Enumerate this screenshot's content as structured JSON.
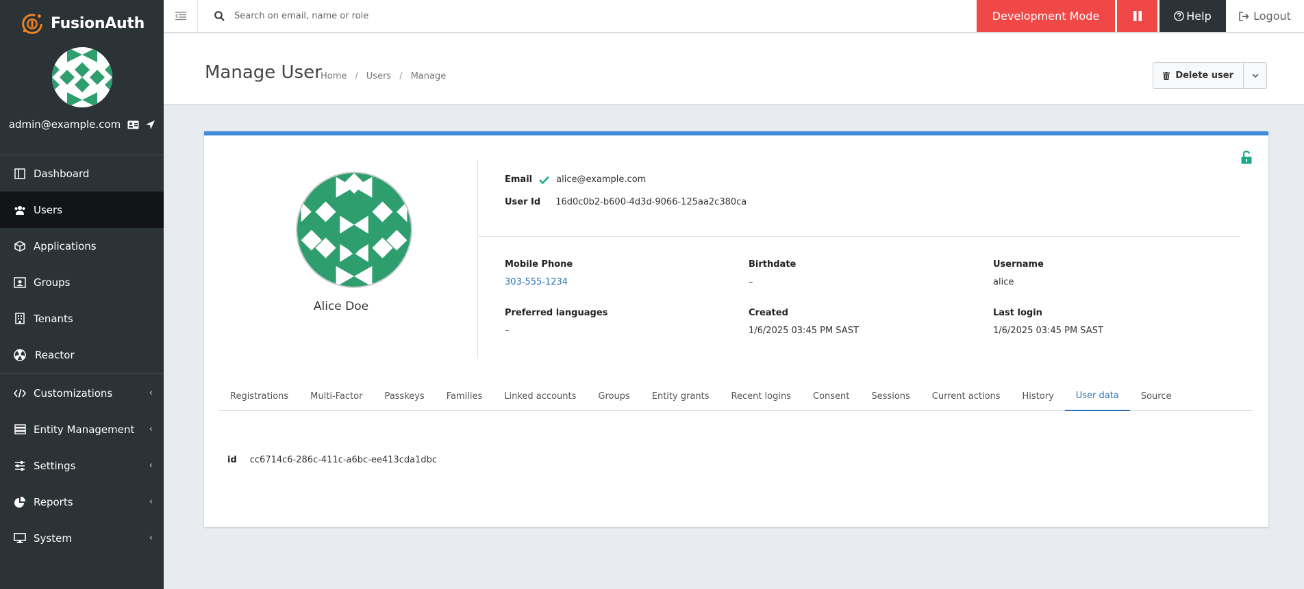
{
  "brand": {
    "name_prefix": "Fusion",
    "name_suffix": "Auth"
  },
  "sidebar": {
    "user_email": "admin@example.com",
    "items": [
      {
        "label": "Dashboard",
        "icon": "dashboard-icon",
        "active": false,
        "chevron": false
      },
      {
        "label": "Users",
        "icon": "users-icon",
        "active": true,
        "chevron": false
      },
      {
        "label": "Applications",
        "icon": "cube-icon",
        "active": false,
        "chevron": false
      },
      {
        "label": "Groups",
        "icon": "groups-icon",
        "active": false,
        "chevron": false
      },
      {
        "label": "Tenants",
        "icon": "building-icon",
        "active": false,
        "chevron": false
      },
      {
        "label": "Reactor",
        "icon": "reactor-icon",
        "active": false,
        "chevron": false
      },
      {
        "label": "Customizations",
        "icon": "code-icon",
        "active": false,
        "chevron": true
      },
      {
        "label": "Entity Management",
        "icon": "server-icon",
        "active": false,
        "chevron": true
      },
      {
        "label": "Settings",
        "icon": "sliders-icon",
        "active": false,
        "chevron": true
      },
      {
        "label": "Reports",
        "icon": "pie-chart-icon",
        "active": false,
        "chevron": true
      },
      {
        "label": "System",
        "icon": "desktop-icon",
        "active": false,
        "chevron": true
      }
    ]
  },
  "topbar": {
    "search_placeholder": "Search on email, name or role",
    "dev_mode_label": "Development Mode",
    "help_label": "Help",
    "logout_label": "Logout"
  },
  "header": {
    "title": "Manage User",
    "breadcrumb": [
      "Home",
      "Users",
      "Manage"
    ],
    "delete_label": "Delete user"
  },
  "user": {
    "name": "Alice Doe",
    "email_label": "Email",
    "email": "alice@example.com",
    "userid_label": "User Id",
    "userid": "16d0c0b2-b600-4d3d-9066-125aa2c380ca",
    "fields": [
      {
        "label": "Mobile Phone",
        "value": "303-555-1234"
      },
      {
        "label": "Birthdate",
        "value": "–"
      },
      {
        "label": "Username",
        "value": "alice"
      },
      {
        "label": "Preferred languages",
        "value": "–"
      },
      {
        "label": "Created",
        "value": "1/6/2025 03:45 PM SAST"
      },
      {
        "label": "Last login",
        "value": "1/6/2025 03:45 PM SAST"
      }
    ]
  },
  "tabs": [
    "Registrations",
    "Multi-Factor",
    "Passkeys",
    "Families",
    "Linked accounts",
    "Groups",
    "Entity grants",
    "Recent logins",
    "Consent",
    "Sessions",
    "Current actions",
    "History",
    "User data",
    "Source"
  ],
  "active_tab": "User data",
  "user_data": {
    "key": "id",
    "value": "cc6714c6-286c-411c-a6bc-ee413cda1dbc"
  },
  "colors": {
    "sidebar_bg": "#2c3336",
    "dev_mode": "#f04747",
    "accent_blue": "#3d8bd9",
    "avatar_green": "#2e9e6e",
    "brand_orange": "#f58320"
  }
}
